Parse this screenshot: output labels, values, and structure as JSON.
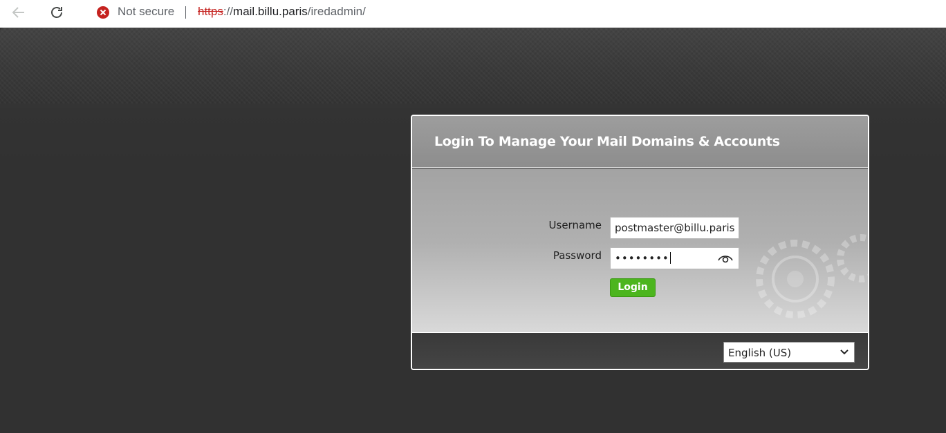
{
  "browser": {
    "security_label": "Not secure",
    "url_scheme": "https",
    "url_sep": "://",
    "url_host": "mail.billu.paris",
    "url_path": "/iredadmin/"
  },
  "login": {
    "title": "Login To Manage Your Mail Domains & Accounts",
    "username_label": "Username",
    "username_value": "postmaster@billu.paris",
    "password_label": "Password",
    "password_mask": "••••••••",
    "button_label": "Login",
    "language_selected": "English (US)"
  },
  "colors": {
    "login_button": "#4cb51e",
    "security_warning": "#c5221f"
  }
}
